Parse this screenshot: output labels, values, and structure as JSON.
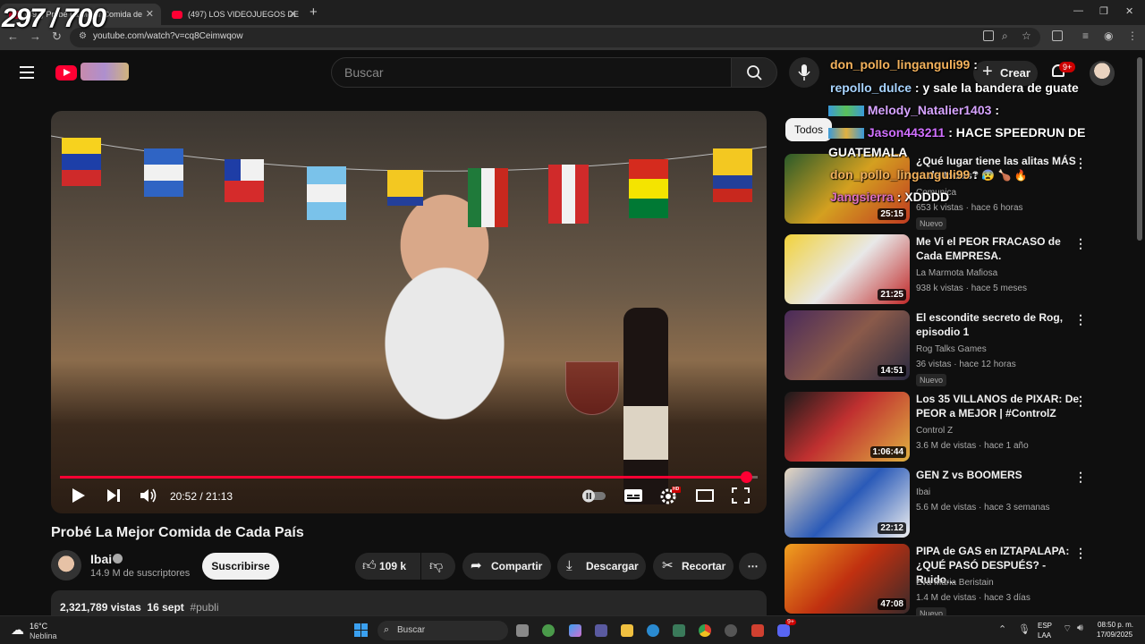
{
  "browser": {
    "tabs": [
      {
        "label": "(497) Probé La Mejor Comida de"
      },
      {
        "label": "(497) LOS VIDEOJUEGOS DE"
      }
    ],
    "url": "youtube.com/watch?v=cq8Ceimwqow"
  },
  "overlay": {
    "counter": "297 / 700"
  },
  "header": {
    "search_placeholder": "Buscar",
    "create_label": "Crear",
    "notif_badge": "9+"
  },
  "player": {
    "time": "20:52 / 21:13",
    "progress": 0.983,
    "hd_badge": "HD"
  },
  "video": {
    "title": "Probé La Mejor Comida de Cada País",
    "channel": "Ibai",
    "subscribers": "14.9 M de suscriptores",
    "subscribe_label": "Suscribirse",
    "likes": "109 k",
    "share_label": "Compartir",
    "download_label": "Descargar",
    "clip_label": "Recortar",
    "views": "2,321,789 vistas",
    "date": "16 sept",
    "hashtag": "#publi"
  },
  "sidebar": {
    "chip_all": "Todos",
    "items": [
      {
        "title": "¿Qué lugar tiene las alitas MÁS ... de todas? 😰 🍗 🔥",
        "channel": "Comunica",
        "meta": "653 k vistas · hace 6 horas",
        "badge": "Nuevo",
        "duration": "25:15"
      },
      {
        "title": "Me Vi el PEOR FRACASO de Cada EMPRESA.",
        "channel": "La Marmota Mafiosa",
        "meta": "938 k vistas · hace 5 meses",
        "badge": "",
        "duration": "21:25"
      },
      {
        "title": "El escondite secreto de Rog, episodio 1",
        "channel": "Rog Talks Games",
        "meta": "36 vistas · hace 12 horas",
        "badge": "Nuevo",
        "duration": "14:51"
      },
      {
        "title": "Los 35 VILLANOS de PIXAR: De PEOR a MEJOR | #ControlZ",
        "channel": "Control Z",
        "meta": "3.6 M de vistas · hace 1 año",
        "badge": "",
        "duration": "1:06:44"
      },
      {
        "title": "GEN Z vs BOOMERS",
        "channel": "Ibai",
        "meta": "5.6 M de vistas · hace 3 semanas",
        "badge": "",
        "duration": "22:12"
      },
      {
        "title": "PIPA de GAS en IZTAPALAPA: ¿QUÉ PASÓ DESPUÉS? - Ruido...",
        "channel": "Eva Maria Beristain",
        "meta": "1.4 M de vistas · hace 3 días",
        "badge": "Nuevo",
        "duration": "47:08"
      }
    ]
  },
  "chat": [
    {
      "user": "don_pollo_linganguli99",
      "msg": ":"
    },
    {
      "user": "repollo_dulce",
      "msg": ": y sale la bandera de guate"
    },
    {
      "user": "Melody_Natalier1403",
      "msg": ":"
    },
    {
      "user": "Jason443211",
      "msg": ": HACE SPEEDRUN DE"
    },
    {
      "user": "",
      "msg": "GUATEMALA"
    },
    {
      "user": "don_pollo_linganguli99",
      "msg": ":"
    },
    {
      "user": "Jangsierra",
      "msg": ": XDDDD"
    }
  ],
  "taskbar": {
    "weather_temp": "16°C",
    "weather_desc": "Neblina",
    "search_label": "Buscar",
    "lang1": "ESP",
    "lang2": "LAA",
    "time": "08:50 p. m.",
    "date": "17/09/2025",
    "discord_badge": "9+"
  },
  "colors": {
    "accent": "#ff0033",
    "background": "#0f0f0f",
    "chip": "#272727"
  }
}
